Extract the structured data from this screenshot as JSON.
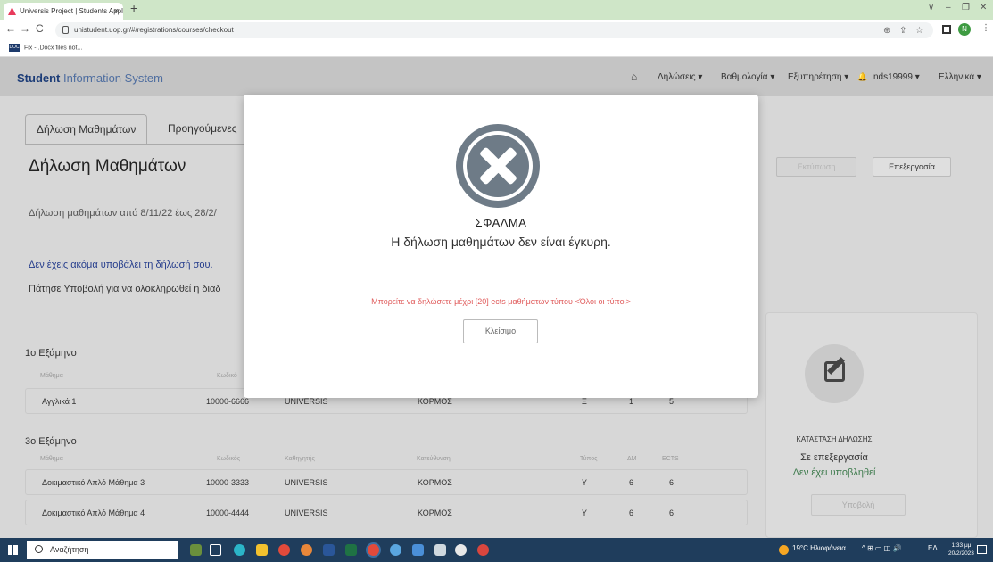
{
  "browser": {
    "tab_title": "Universis Project | Students Appl",
    "tab_close": "×",
    "new_tab": "+",
    "win_min": "∨",
    "win_min2": "–",
    "win_restore": "❐",
    "win_close": "✕",
    "back": "←",
    "forward": "→",
    "reload": "C",
    "url": "unistudent.uop.gr/#/registrations/courses/checkout",
    "bookmark_label": "Fix - .Docx files not...",
    "bookmark_icon_text": "DOC",
    "profile_initial": "N",
    "more": "⋮"
  },
  "header": {
    "brand_bold": "Student",
    "brand_light": " Information System",
    "home_icon": "⌂",
    "menu": {
      "declarations": "Δηλώσεις ▾",
      "grades": "Βαθμολογία ▾",
      "service": "Εξυπηρέτηση ▾",
      "bell": "🔔",
      "user": "nds19999 ▾",
      "language": "Ελληνικά ▾"
    }
  },
  "page": {
    "tabs": [
      "Δήλωση Μαθημάτων",
      "Προηγούμενες"
    ],
    "title": "Δήλωση Μαθημάτων",
    "period": "Δήλωση μαθημάτων από 8/11/22 έως 28/2/",
    "not_submitted": "Δεν έχεις ακόμα υποβάλει τη δήλωσή σου.",
    "press_submit": "Πάτησε Υποβολή για να ολοκληρωθεί η διαδ",
    "print_button": "Εκτύπωση",
    "process_button": "Επεξεργασία"
  },
  "semesters": [
    {
      "title": "1ο Εξάμηνο",
      "headers": [
        "Μάθημα",
        "Κωδικό"
      ],
      "rows": [
        {
          "course": "Αγγλικά 1",
          "code": "10000-6666",
          "instructor": "UNIVERSIS",
          "direction": "ΚΟΡΜΟΣ",
          "type": "Ξ",
          "dm": "1",
          "ects": "5"
        }
      ]
    },
    {
      "title": "3ο Εξάμηνο",
      "headers": [
        "Μάθημα",
        "Κωδικός",
        "Καθηγητής",
        "Κατεύθυνση",
        "Τύπος",
        "ΔΜ",
        "ECTS"
      ],
      "rows": [
        {
          "course": "Δοκιμαστικό Απλό Μάθημα 3",
          "code": "10000-3333",
          "instructor": "UNIVERSIS",
          "direction": "ΚΟΡΜΟΣ",
          "type": "Υ",
          "dm": "6",
          "ects": "6"
        },
        {
          "course": "Δοκιμαστικό Απλό Μάθημα 4",
          "code": "10000-4444",
          "instructor": "UNIVERSIS",
          "direction": "ΚΟΡΜΟΣ",
          "type": "Υ",
          "dm": "6",
          "ects": "6"
        }
      ]
    }
  ],
  "status": {
    "label": "ΚΑΤΑΣΤΑΣΗ ΔΗΛΩΣΗΣ",
    "value": "Σε επεξεργασία",
    "sub": "Δεν έχει υποβληθεί",
    "submit_button": "Υποβολή"
  },
  "modal": {
    "title": "ΣΦΑΛΜΑ",
    "message": "Η δήλωση μαθημάτων δεν είναι έγκυρη.",
    "detail": "Μπορείτε να δηλώσετε μέχρι [20] ects μαθήματων τύπου <Όλοι οι τύποι>",
    "close_button": "Κλείσιμο"
  },
  "taskbar": {
    "search_text": "Αναζήτηση",
    "weather": "19°C Ηλιοφάνεια",
    "tray_icons": "^ ⊞ ▭ ◫ 🔊",
    "lang": "ΕΛ",
    "time": "1:33 μμ",
    "date": "20/2/2023"
  },
  "colors": {
    "brand": "#1c3c77",
    "error_icon": "#6e7b87",
    "error_text": "#e05c5c",
    "success": "#3d7a4c",
    "taskbar": "#1f3d5c"
  }
}
